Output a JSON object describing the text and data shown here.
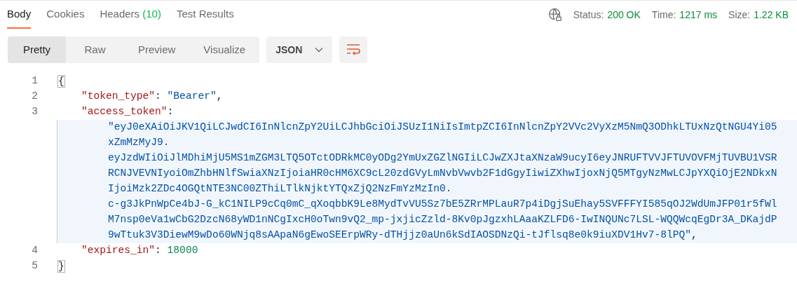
{
  "tabs": [
    {
      "label": "Body",
      "selected": true
    },
    {
      "label": "Cookies",
      "selected": false
    },
    {
      "label": "Headers",
      "count": "(10)",
      "selected": false
    },
    {
      "label": "Test Results",
      "selected": false
    }
  ],
  "status": [
    {
      "label": "Status:",
      "value": "200 OK"
    },
    {
      "label": "Time:",
      "value": "1217 ms"
    },
    {
      "label": "Size:",
      "value": "1.22 KB"
    }
  ],
  "view_modes": [
    {
      "label": "Pretty",
      "selected": true
    },
    {
      "label": "Raw",
      "selected": false
    },
    {
      "label": "Preview",
      "selected": false
    },
    {
      "label": "Visualize",
      "selected": false
    }
  ],
  "format_dropdown": {
    "value": "JSON"
  },
  "code_lines": [
    {
      "number": "1",
      "kind": "brace",
      "text": "{",
      "matched": true
    },
    {
      "number": "2",
      "kind": "string_pair",
      "key": "\"token_type\"",
      "sep": ": ",
      "value": "\"Bearer\"",
      "end": ","
    },
    {
      "number": "3",
      "kind": "wrapped",
      "key": "\"access_token\"",
      "sep": ":",
      "selected": true,
      "value_lines": [
        "\"eyJ0eXAiOiJKV1QiLCJwdCI6InNlcnZpY2UiLCJhbGciOiJSUzI1NiIsImtpZCI6InNlcnZpY2VVc2VyXzM5NmQ3ODhkLTUxNzQtNGU4Yi05",
        "xZmMzMyJ9.",
        "eyJzdWIiOiJlMDhiMjU5MS1mZGM3LTQ5OTctODRkMC0yODg2YmUxZGZlNGIiLCJwZXJtaXNzaW9ucyI6eyJNRUFTVVJFTUVOVFMjTUVBU1VSR",
        "RCNJVEVNIyoiOmZhbHNlfSwiaXNzIjoiaHR0cHM6XC9cL20zdGVyLmNvbVwvb2F1dGgyIiwiZXhwIjoxNjQ5MTgyNzMwLCJpYXQiOjE2NDkxN",
        "IjoiMzk2ZDc4OGQtNTE3NC00ZThiLTlkNjktYTQxZjQ2NzFmYzMzIn0.",
        "c-g3JkPnWpCe4bJ-G_kC1NILP9cCq0mC_qXoqbbK9Le8MydTvVU5Sz7bE5ZRrMPLauR7p4iDgjSuEhay5SVFFFYI585qOJ2WdUmJFP01r5fWl",
        "M7nsp0eVa1wCbG2DzcN68yWD1nNCgIxcH0oTwn9vQ2_mp-jxjicZzld-8Kv0pJgzxhLAaaKZLFD6-IwINQUNc7LSL-WQQWcqEgDr3A_DKajdP",
        "9wTtuk3V3DiewM9wDo60WNjq8sAApaN6gEwoSEErpWRy-dTHjjz0aUn6kSdIAOSDNzQi-tJflsq8e0k9iuXDV1Hv7-8lPQ\""
      ],
      "end": ","
    },
    {
      "number": "4",
      "kind": "number_pair",
      "key": "\"expires_in\"",
      "sep": ": ",
      "value": "18000"
    },
    {
      "number": "5",
      "kind": "brace",
      "text": "}",
      "matched": true
    }
  ]
}
